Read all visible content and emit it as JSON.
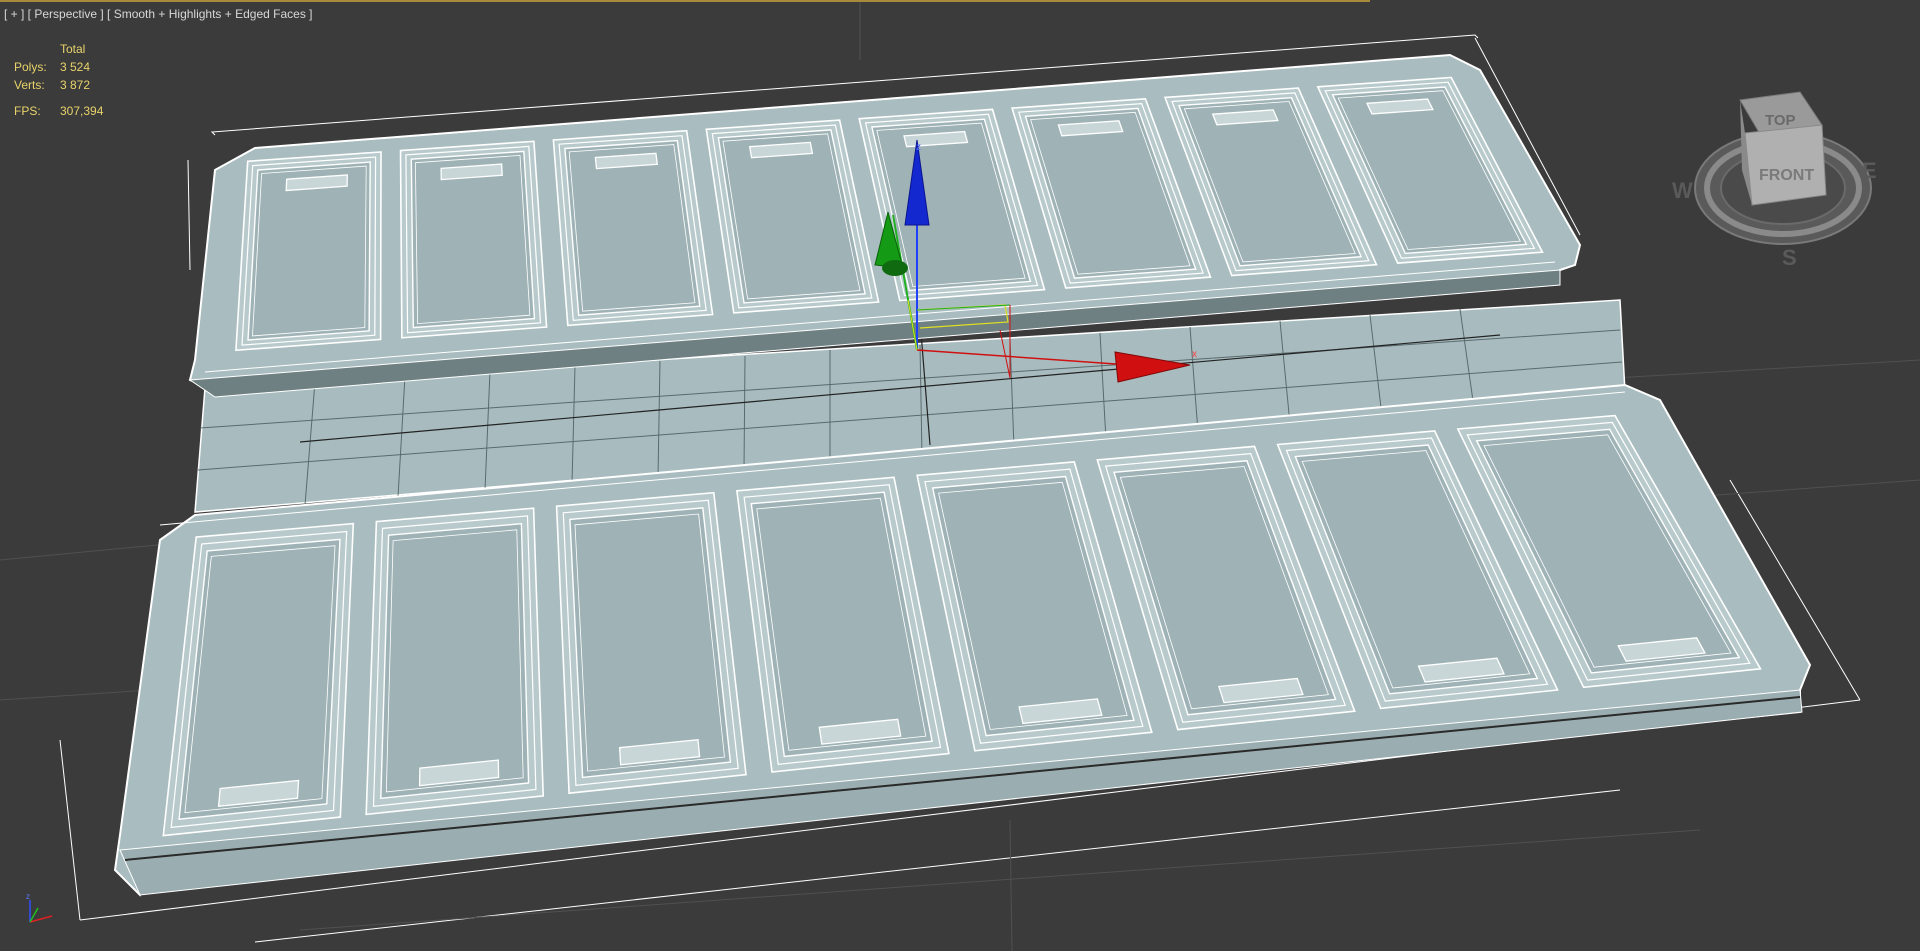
{
  "viewport": {
    "label": "[ + ] [ Perspective ] [ Smooth + Highlights + Edged Faces ]"
  },
  "stats": {
    "header": "Total",
    "polys_label": "Polys:",
    "polys_value": "3 524",
    "verts_label": "Verts:",
    "verts_value": "3 872",
    "fps_label": "FPS:",
    "fps_value": "307,394"
  },
  "viewcube": {
    "top": "TOP",
    "front": "FRONT",
    "west": "W",
    "east": "E",
    "south": "S"
  },
  "gizmo": {
    "x": "x",
    "z": "z"
  },
  "colors": {
    "background": "#3b3b3b",
    "mesh_fill": "#a9bcbf",
    "mesh_edge": "#ffffff",
    "stats_text": "#e8d36a",
    "axis_x": "#d01010",
    "axis_y": "#18a018",
    "axis_z": "#1030d0"
  },
  "icons": [
    "move-gizmo-icon",
    "viewcube-icon",
    "world-axis-icon"
  ]
}
